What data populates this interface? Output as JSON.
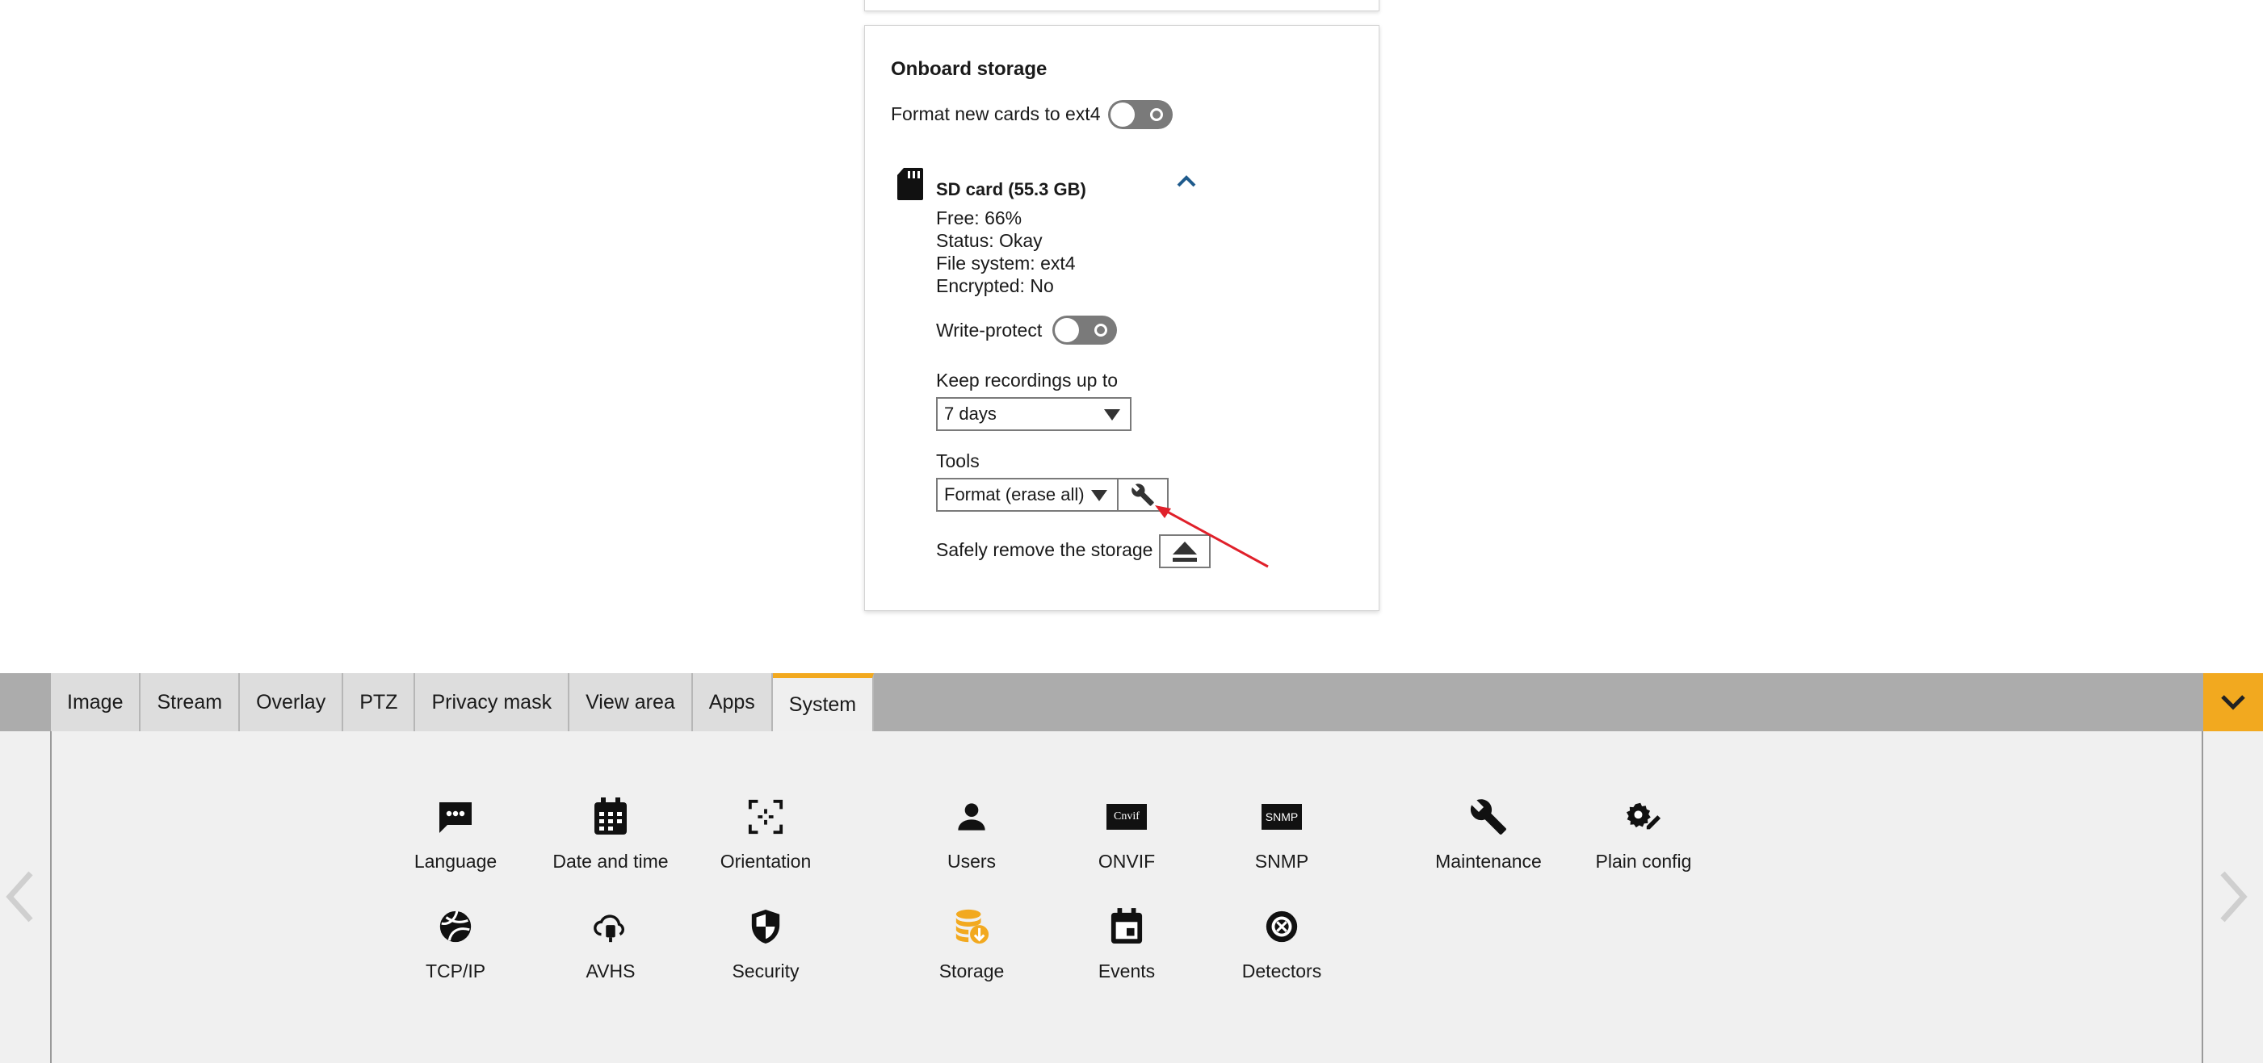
{
  "panel": {
    "title": "Onboard storage",
    "format_label": "Format new cards to ext4",
    "card_title": "SD card (55.3 GB)",
    "free": "Free: 66%",
    "status": "Status: Okay",
    "filesystem": "File system: ext4",
    "encrypted": "Encrypted: No",
    "write_protect_label": "Write-protect",
    "keep_label": "Keep recordings up to",
    "keep_value": "7 days",
    "tools_label": "Tools",
    "tools_value": "Format (erase all)",
    "safe_remove_label": "Safely remove the storage"
  },
  "tabs": [
    {
      "label": "Image"
    },
    {
      "label": "Stream"
    },
    {
      "label": "Overlay"
    },
    {
      "label": "PTZ"
    },
    {
      "label": "Privacy mask"
    },
    {
      "label": "View area"
    },
    {
      "label": "Apps"
    },
    {
      "label": "System",
      "active": true
    }
  ],
  "system_items": [
    {
      "label": "Language",
      "icon": "chat-icon"
    },
    {
      "label": "Date and time",
      "icon": "calendar-icon"
    },
    {
      "label": "Orientation",
      "icon": "focus-frame-icon"
    },
    {
      "label": "Users",
      "icon": "user-icon"
    },
    {
      "label": "ONVIF",
      "icon": "onvif-icon",
      "icon_text": "Cnvif"
    },
    {
      "label": "SNMP",
      "icon": "snmp-icon",
      "icon_text": "SNMP"
    },
    {
      "label": "Maintenance",
      "icon": "wrench-icon"
    },
    {
      "label": "Plain config",
      "icon": "gear-pen-icon"
    },
    {
      "label": "TCP/IP",
      "icon": "network-icon"
    },
    {
      "label": "AVHS",
      "icon": "cloud-icon"
    },
    {
      "label": "Security",
      "icon": "shield-icon"
    },
    {
      "label": "Storage",
      "icon": "database-icon",
      "active": true
    },
    {
      "label": "Events",
      "icon": "event-calendar-icon"
    },
    {
      "label": "Detectors",
      "icon": "detector-icon"
    }
  ],
  "colors": {
    "accent": "#f2a91f",
    "chevron": "#1f5b8c",
    "annotation": "#e0202a"
  }
}
